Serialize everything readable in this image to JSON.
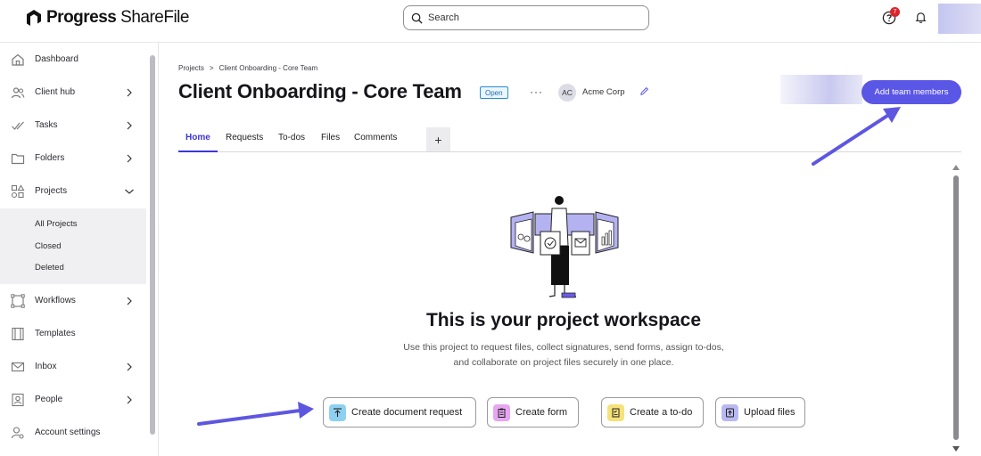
{
  "app": {
    "brand_bold": "Progress",
    "brand_light": "ShareFile"
  },
  "search": {
    "placeholder": "Search"
  },
  "header": {
    "notification_count": "7"
  },
  "sidebar": {
    "items": [
      {
        "label": "Dashboard",
        "icon": "home-icon"
      },
      {
        "label": "Client hub",
        "icon": "users-icon"
      },
      {
        "label": "Tasks",
        "icon": "check-icon"
      },
      {
        "label": "Folders",
        "icon": "folder-icon"
      },
      {
        "label": "Projects",
        "icon": "shapes-icon"
      },
      {
        "label": "Workflows",
        "icon": "workflow-icon"
      },
      {
        "label": "Templates",
        "icon": "template-icon"
      },
      {
        "label": "Inbox",
        "icon": "mail-icon"
      },
      {
        "label": "People",
        "icon": "person-icon"
      },
      {
        "label": "Account settings",
        "icon": "settings-icon"
      }
    ],
    "projects_sub": [
      "All Projects",
      "Closed",
      "Deleted"
    ]
  },
  "breadcrumb": {
    "root": "Projects",
    "sep": ">",
    "current": "Client Onboarding - Core Team"
  },
  "project": {
    "title": "Client Onboarding - Core Team",
    "status": "Open",
    "more": "···",
    "client_initials": "AC",
    "client_name": "Acme Corp",
    "add_members_label": "Add team members"
  },
  "tabs": [
    "Home",
    "Requests",
    "To-dos",
    "Files",
    "Comments"
  ],
  "tab_add": "+",
  "hero": {
    "title": "This is your project workspace",
    "desc_line1": "Use this project to request files, collect signatures, send forms, assign to-dos,",
    "desc_line2": "and collaborate on project files securely in one place."
  },
  "actions": [
    {
      "label": "Create document request",
      "icon": "upload-icon",
      "color": "#8fd0f2"
    },
    {
      "label": "Create form",
      "icon": "clipboard-icon",
      "color": "#e7a6f0"
    },
    {
      "label": "Create a to-do",
      "icon": "checklist-icon",
      "color": "#f5e27a"
    },
    {
      "label": "Upload files",
      "icon": "file-upload-icon",
      "color": "#b9b9f2"
    }
  ],
  "colors": {
    "accent": "#5a56e6",
    "arrow": "#5d57e0"
  }
}
